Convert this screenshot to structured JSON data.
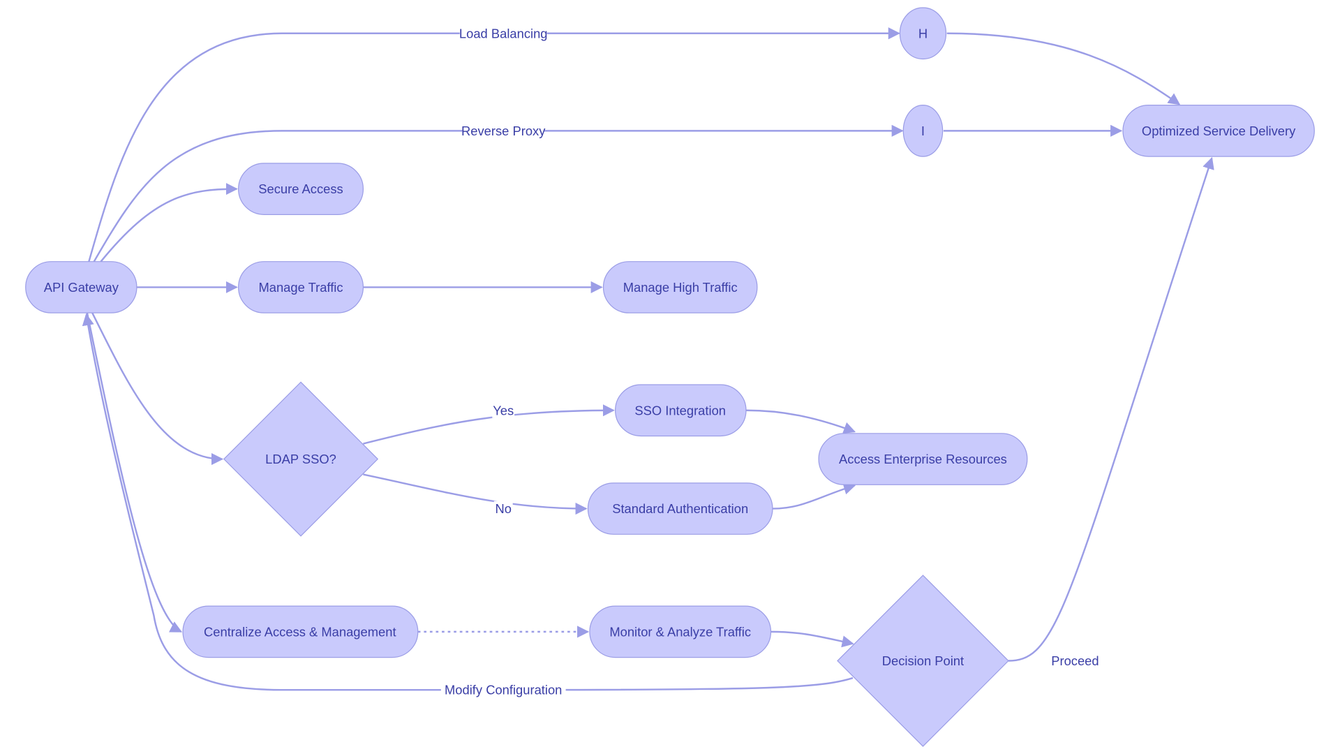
{
  "colors": {
    "node_fill": "#c9cafc",
    "node_stroke": "#9b9de6",
    "edge": "#9b9de6",
    "text": "#3a3ea6"
  },
  "nodes": {
    "api": "API Gateway",
    "secure": "Secure Access",
    "manage": "Manage Traffic",
    "high": "Manage High Traffic",
    "h": "H",
    "i": "I",
    "osd": "Optimized Service Delivery",
    "ldap": "LDAP SSO?",
    "sso": "SSO Integration",
    "std": "Standard Authentication",
    "aer": "Access Enterprise Resources",
    "central": "Centralize Access & Management",
    "monitor": "Monitor & Analyze Traffic",
    "decision": "Decision Point"
  },
  "edge_labels": {
    "load": "Load Balancing",
    "proxy": "Reverse Proxy",
    "yes": "Yes",
    "no": "No",
    "proceed": "Proceed",
    "modify": "Modify Configuration"
  }
}
